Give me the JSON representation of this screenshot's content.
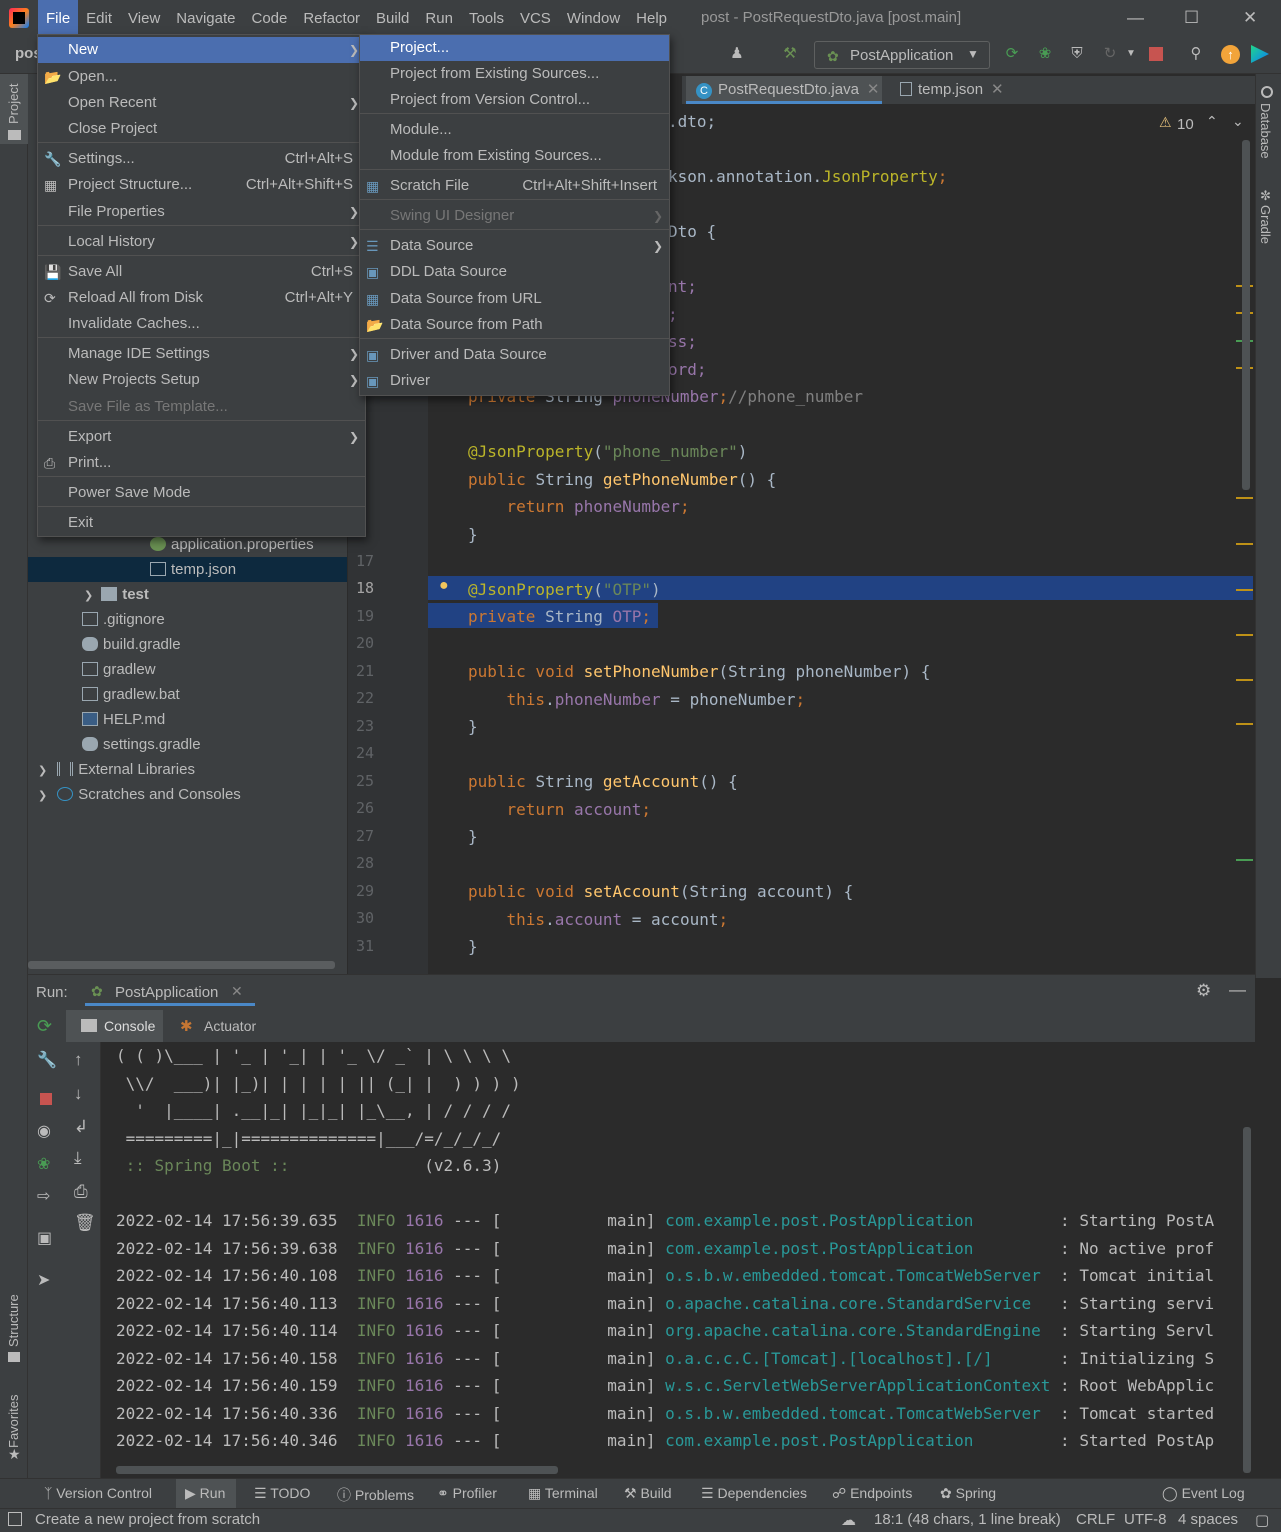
{
  "window": {
    "title": "post - PostRequestDto.java [post.main]",
    "project_label": "pos"
  },
  "menubar": [
    "File",
    "Edit",
    "View",
    "Navigate",
    "Code",
    "Refactor",
    "Build",
    "Run",
    "Tools",
    "VCS",
    "Window",
    "Help"
  ],
  "toolbar": {
    "run_config": "PostApplication"
  },
  "file_menu": [
    {
      "label": "New",
      "submenu": true,
      "selected": true
    },
    {
      "label": "Open..."
    },
    {
      "label": "Open Recent",
      "submenu": true
    },
    {
      "label": "Close Project"
    },
    {
      "label": "Settings...",
      "shortcut": "Ctrl+Alt+S"
    },
    {
      "label": "Project Structure...",
      "shortcut": "Ctrl+Alt+Shift+S"
    },
    {
      "label": "File Properties",
      "submenu": true
    },
    {
      "label": "Local History",
      "submenu": true
    },
    {
      "label": "Save All",
      "shortcut": "Ctrl+S"
    },
    {
      "label": "Reload All from Disk",
      "shortcut": "Ctrl+Alt+Y"
    },
    {
      "label": "Invalidate Caches..."
    },
    {
      "label": "Manage IDE Settings",
      "submenu": true
    },
    {
      "label": "New Projects Setup",
      "submenu": true
    },
    {
      "label": "Save File as Template...",
      "disabled": true
    },
    {
      "label": "Export",
      "submenu": true
    },
    {
      "label": "Print..."
    },
    {
      "label": "Power Save Mode"
    },
    {
      "label": "Exit"
    }
  ],
  "new_submenu": [
    {
      "label": "Project...",
      "selected": true
    },
    {
      "label": "Project from Existing Sources..."
    },
    {
      "label": "Project from Version Control..."
    },
    {
      "label": "Module..."
    },
    {
      "label": "Module from Existing Sources..."
    },
    {
      "label": "Scratch File",
      "shortcut": "Ctrl+Alt+Shift+Insert"
    },
    {
      "label": "Swing UI Designer",
      "disabled": true,
      "submenu": true
    },
    {
      "label": "Data Source",
      "submenu": true
    },
    {
      "label": "DDL Data Source"
    },
    {
      "label": "Data Source from URL"
    },
    {
      "label": "Data Source from Path"
    },
    {
      "label": "Driver and Data Source"
    },
    {
      "label": "Driver"
    }
  ],
  "project_tree": [
    {
      "label": "application.properties"
    },
    {
      "label": "temp.json",
      "selected": true
    },
    {
      "label": "test"
    },
    {
      "label": ".gitignore"
    },
    {
      "label": "build.gradle"
    },
    {
      "label": "gradlew"
    },
    {
      "label": "gradlew.bat"
    },
    {
      "label": "HELP.md"
    },
    {
      "label": "settings.gradle"
    },
    {
      "label": "External Libraries"
    },
    {
      "label": "Scratches and Consoles"
    }
  ],
  "editor_tabs": [
    {
      "label": "PostRequestDto.java",
      "active": true
    },
    {
      "label": "temp.json"
    }
  ],
  "inspection": {
    "warnings": "10"
  },
  "code": {
    "fragments": {
      "l1": ".dto;",
      "l3a": "kson.annotation.",
      "l3b": "JsonProperty",
      "l3c": ";",
      "l5": "Dto {",
      "l7": "nt;",
      "l8": ";",
      "l9": "ss;",
      "l10": "ord;"
    },
    "line_numbers": [
      "17",
      "18",
      "19",
      "20",
      "21",
      "22",
      "23",
      "24",
      "25",
      "26",
      "27",
      "28",
      "29",
      "30",
      "31"
    ]
  },
  "run_panel": {
    "label": "Run:",
    "config": "PostApplication",
    "tabs": [
      "Console",
      "Actuator"
    ]
  },
  "console": {
    "banner": [
      "( ( )\\___ | '_ | '_| | '_ \\/ _` | \\ \\ \\ \\",
      " \\\\/  ___)| |_)| | | | | || (_| |  ) ) ) )",
      "  '  |____| .__|_| |_|_| |_\\__, | / / / /",
      " =========|_|==============|___/=/_/_/_/"
    ],
    "spring_label": " :: Spring Boot :: ",
    "spring_version": "(v2.6.3)",
    "logs": [
      {
        "ts": "2022-02-14 17:56:39.635",
        "level": "INFO",
        "pid": "1616",
        "thread": "main",
        "cls": "com.example.post.PostApplication",
        "msg": ": Starting PostA"
      },
      {
        "ts": "2022-02-14 17:56:39.638",
        "level": "INFO",
        "pid": "1616",
        "thread": "main",
        "cls": "com.example.post.PostApplication",
        "msg": ": No active prof"
      },
      {
        "ts": "2022-02-14 17:56:40.108",
        "level": "INFO",
        "pid": "1616",
        "thread": "main",
        "cls": "o.s.b.w.embedded.tomcat.TomcatWebServer",
        "msg": ": Tomcat initial"
      },
      {
        "ts": "2022-02-14 17:56:40.113",
        "level": "INFO",
        "pid": "1616",
        "thread": "main",
        "cls": "o.apache.catalina.core.StandardService",
        "msg": ": Starting servi"
      },
      {
        "ts": "2022-02-14 17:56:40.114",
        "level": "INFO",
        "pid": "1616",
        "thread": "main",
        "cls": "org.apache.catalina.core.StandardEngine",
        "msg": ": Starting Servl"
      },
      {
        "ts": "2022-02-14 17:56:40.158",
        "level": "INFO",
        "pid": "1616",
        "thread": "main",
        "cls": "o.a.c.c.C.[Tomcat].[localhost].[/]",
        "msg": ": Initializing S"
      },
      {
        "ts": "2022-02-14 17:56:40.159",
        "level": "INFO",
        "pid": "1616",
        "thread": "main",
        "cls": "w.s.c.ServletWebServerApplicationContext",
        "msg": ": Root WebApplic"
      },
      {
        "ts": "2022-02-14 17:56:40.336",
        "level": "INFO",
        "pid": "1616",
        "thread": "main",
        "cls": "o.s.b.w.embedded.tomcat.TomcatWebServer",
        "msg": ": Tomcat started"
      },
      {
        "ts": "2022-02-14 17:56:40.346",
        "level": "INFO",
        "pid": "1616",
        "thread": "main",
        "cls": "com.example.post.PostApplication",
        "msg": ": Started PostAp"
      }
    ]
  },
  "side_tools": {
    "left": [
      "Project",
      "Structure",
      "Favorites"
    ],
    "right": [
      "Database",
      "Gradle"
    ]
  },
  "bottom_tools": [
    "Version Control",
    "Run",
    "TODO",
    "Problems",
    "Profiler",
    "Terminal",
    "Build",
    "Dependencies",
    "Endpoints",
    "Spring",
    "Event Log"
  ],
  "status": {
    "message": "Create a new project from scratch",
    "position": "18:1 (48 chars, 1 line break)",
    "line_sep": "CRLF",
    "encoding": "UTF-8",
    "indent": "4 spaces"
  },
  "colors": {
    "accent": "#4b6eaf",
    "bg": "#2b2b2b",
    "panel": "#3c3f41"
  }
}
